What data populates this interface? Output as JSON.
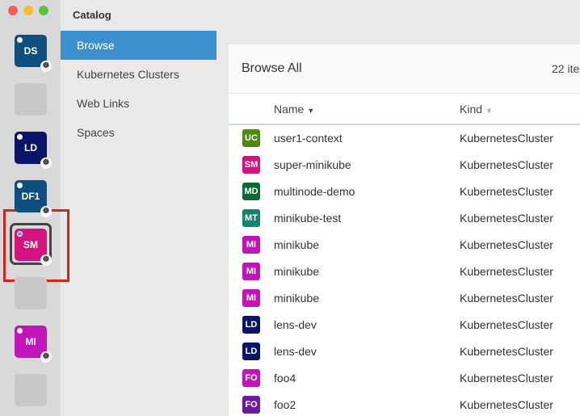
{
  "window": {
    "title": "Catalog"
  },
  "hotbar": {
    "items": [
      {
        "initials": "DS",
        "color": "#0e4f7f"
      },
      {
        "initials": "",
        "color": "#c8c8c8"
      },
      {
        "initials": "LD",
        "color": "#0a1468"
      },
      {
        "initials": "DF1",
        "color": "#0e4f7f"
      },
      {
        "initials": "SM",
        "color": "#d3147e",
        "active": true
      },
      {
        "initials": "",
        "color": "#c8c8c8"
      },
      {
        "initials": "MI",
        "color": "#c215b9"
      },
      {
        "initials": "",
        "color": "#c8c8c8"
      }
    ],
    "k8s_icon": "☸"
  },
  "nav": {
    "items": [
      "Browse",
      "Kubernetes Clusters",
      "Web Links",
      "Spaces"
    ],
    "active_index": 0
  },
  "main": {
    "title": "Browse All",
    "count": "22 ite",
    "columns": {
      "name": "Name",
      "kind": "Kind"
    },
    "rows": [
      {
        "initials": "UC",
        "name": "user1-context",
        "kind": "KubernetesCluster",
        "color": "#4f8a10"
      },
      {
        "initials": "SM",
        "name": "super-minikube",
        "kind": "KubernetesCluster",
        "color": "#d3147e"
      },
      {
        "initials": "MD",
        "name": "multinode-demo",
        "kind": "KubernetesCluster",
        "color": "#0c6b35"
      },
      {
        "initials": "MT",
        "name": "minikube-test",
        "kind": "KubernetesCluster",
        "color": "#11856d"
      },
      {
        "initials": "MI",
        "name": "minikube",
        "kind": "KubernetesCluster",
        "color": "#c215b9"
      },
      {
        "initials": "MI",
        "name": "minikube",
        "kind": "KubernetesCluster",
        "color": "#c215b9"
      },
      {
        "initials": "MI",
        "name": "minikube",
        "kind": "KubernetesCluster",
        "color": "#c215b9"
      },
      {
        "initials": "LD",
        "name": "lens-dev",
        "kind": "KubernetesCluster",
        "color": "#0a1468"
      },
      {
        "initials": "LD",
        "name": "lens-dev",
        "kind": "KubernetesCluster",
        "color": "#0a1468"
      },
      {
        "initials": "FO",
        "name": "foo4",
        "kind": "KubernetesCluster",
        "color": "#c215b9"
      },
      {
        "initials": "FO",
        "name": "foo2",
        "kind": "KubernetesCluster",
        "color": "#6a1aa3"
      }
    ]
  }
}
